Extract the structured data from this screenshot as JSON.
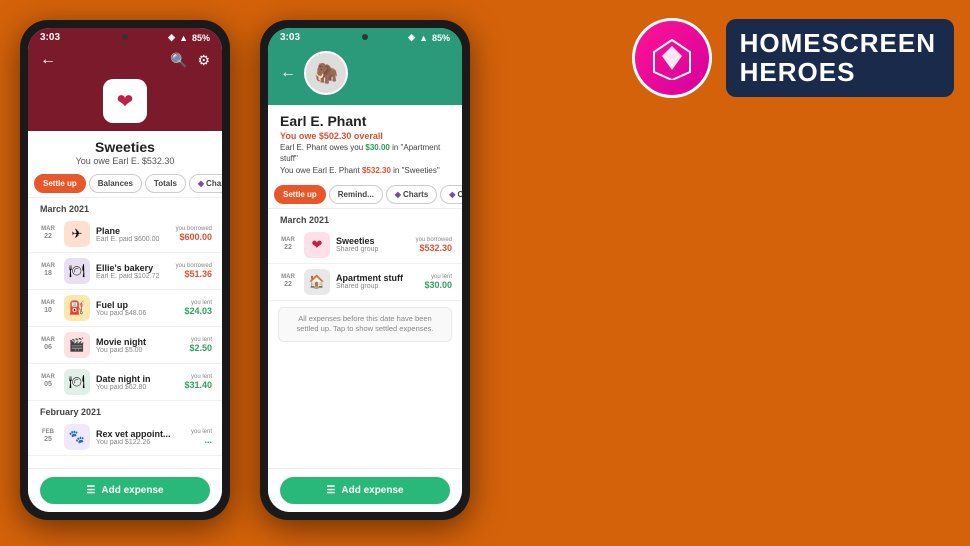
{
  "background_color": "#D4620A",
  "hero": {
    "title_line1": "HOMESCREEN",
    "title_line2": "HEROES"
  },
  "phone1": {
    "time": "3:03",
    "battery": "85%",
    "header": {
      "app_name": "Sweeties",
      "subtitle": "You owe Earl E. $532.30"
    },
    "tabs": [
      {
        "label": "Settle up",
        "active": true
      },
      {
        "label": "Balances",
        "active": false
      },
      {
        "label": "Totals",
        "active": false
      },
      {
        "label": "Cha...",
        "active": false,
        "has_diamond": true
      }
    ],
    "section": "March 2021",
    "expenses": [
      {
        "month": "Mar",
        "day": "22",
        "name": "Plane",
        "paid_by": "Earl E. paid $600.00",
        "label": "you borrowed",
        "amount": "$600.00",
        "type": "borrowed",
        "icon": "✈"
      },
      {
        "month": "Mar",
        "day": "18",
        "name": "Ellie's bakery",
        "paid_by": "Earl E. paid $102.72",
        "label": "you borrowed",
        "amount": "$51.36",
        "type": "borrowed",
        "icon": "🍽"
      },
      {
        "month": "Mar",
        "day": "10",
        "name": "Fuel up",
        "paid_by": "You paid $48.06",
        "label": "you lent",
        "amount": "$24.03",
        "type": "lent",
        "icon": "⛽"
      },
      {
        "month": "Mar",
        "day": "06",
        "name": "Movie night",
        "paid_by": "You paid $5.00",
        "label": "you lent",
        "amount": "$2.50",
        "type": "lent",
        "icon": "🎬"
      },
      {
        "month": "Mar",
        "day": "05",
        "name": "Date night in",
        "paid_by": "You paid $62.80",
        "label": "you lent",
        "amount": "$31.40",
        "type": "lent",
        "icon": "🍽"
      }
    ],
    "section2": "February 2021",
    "expenses2": [
      {
        "month": "Feb",
        "day": "25",
        "name": "Rex vet appoint...",
        "paid_by": "You paid $122.26",
        "label": "you lent",
        "amount": "...",
        "type": "lent",
        "icon": "🐾"
      }
    ],
    "add_expense_label": "Add expense"
  },
  "phone2": {
    "time": "3:03",
    "battery": "85%",
    "contact": {
      "name": "Earl E. Phant",
      "owe_overall": "You owe $502.30 overall",
      "detail1": "Earl E. Phant owes you $30.00 in \"Apartment stuff\"",
      "detail1_amount": "$30.00",
      "detail2": "You owe Earl E. Phant $532.30 in \"Sweeties\"",
      "detail2_amount": "$532.30"
    },
    "tabs": [
      {
        "label": "Settle up",
        "active": true
      },
      {
        "label": "Remind...",
        "active": false
      },
      {
        "label": "Charts",
        "active": false,
        "has_diamond": true
      },
      {
        "label": "C...",
        "active": false,
        "has_diamond": true
      }
    ],
    "section": "March 2021",
    "expenses": [
      {
        "month": "Mar",
        "day": "22",
        "name": "Sweeties",
        "paid_by": "Shared group",
        "label": "you borrowed",
        "amount": "$532.30",
        "type": "borrowed",
        "icon": "❤"
      },
      {
        "month": "Mar",
        "day": "22",
        "name": "Apartment stuff",
        "paid_by": "Shared group",
        "label": "you lent",
        "amount": "$30.00",
        "type": "lent",
        "icon": "🏠"
      }
    ],
    "settled_notice": "All expenses before this date have been settled up. Tap to show settled expenses.",
    "add_expense_label": "Add expense"
  }
}
